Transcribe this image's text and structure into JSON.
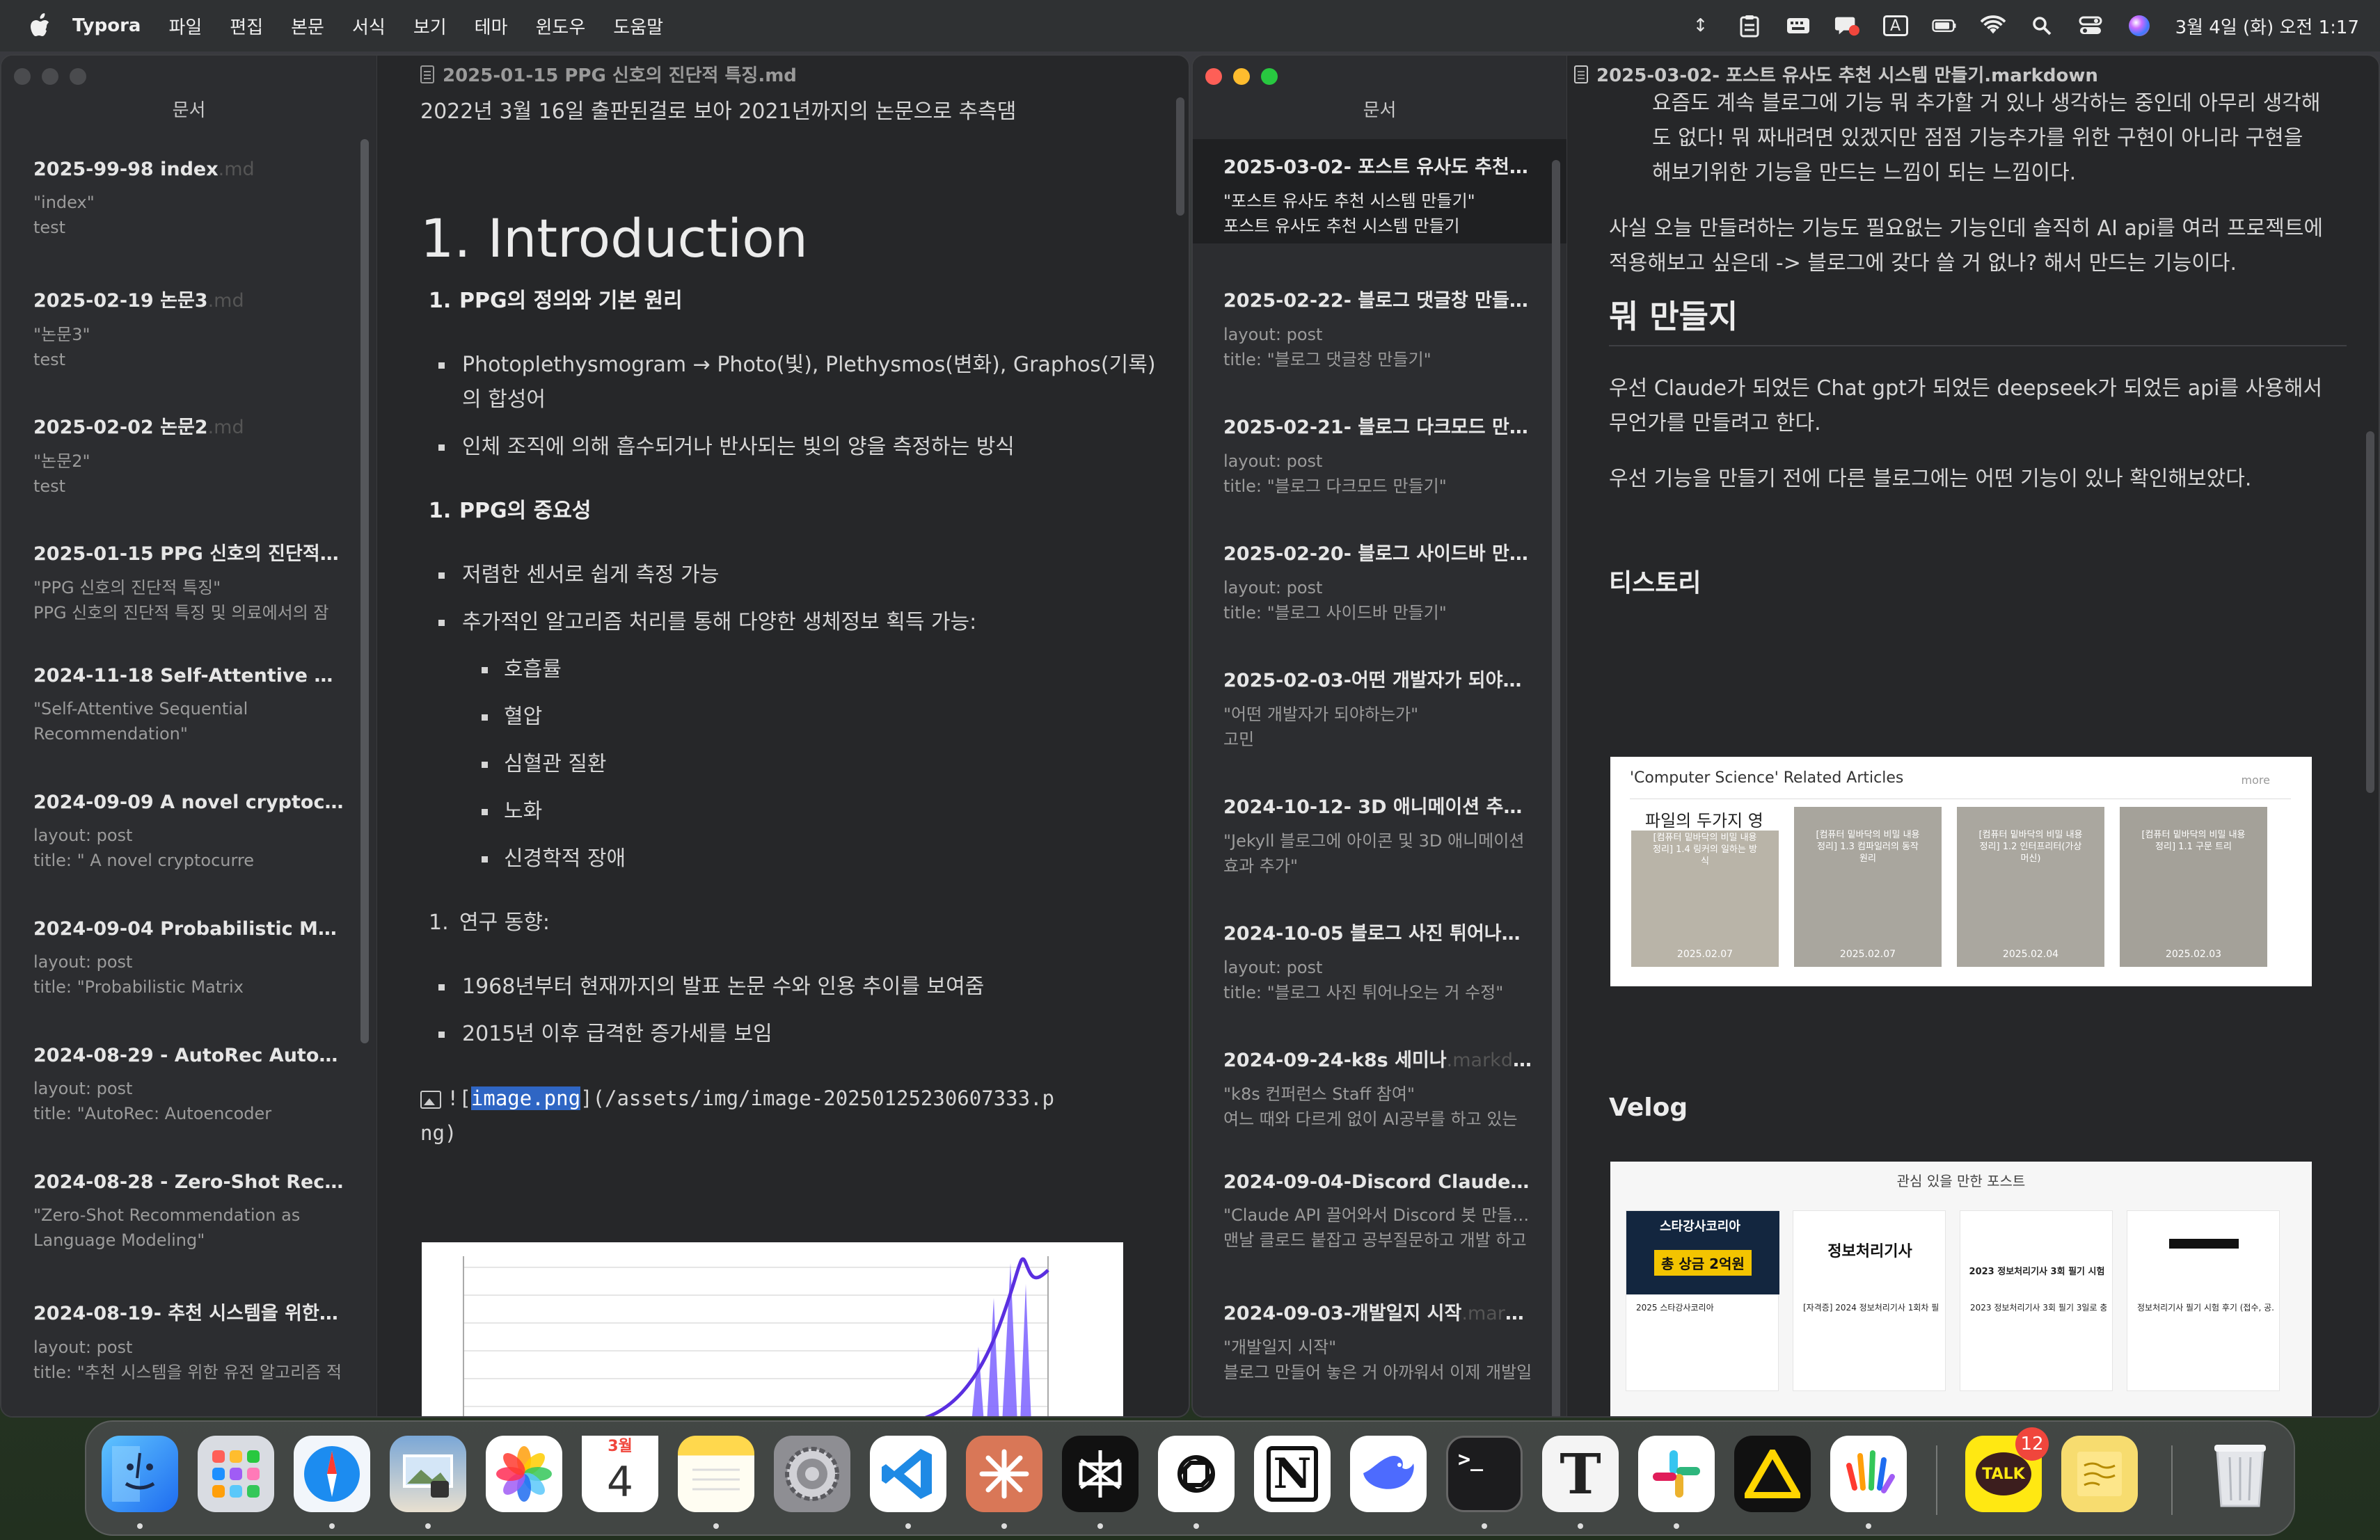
{
  "menubar": {
    "app_name": "Typora",
    "menus": [
      "파일",
      "편집",
      "본문",
      "서식",
      "보기",
      "테마",
      "윈도우",
      "도움말"
    ],
    "input_indicator": "A",
    "clock": "3월 4일 (화) 오전 1:17"
  },
  "left_window": {
    "sidebar_title": "문서",
    "files": [
      {
        "title": "2025-99-98 index",
        "ext": ".md",
        "line1": "\"index\"",
        "line2": "test"
      },
      {
        "title": "2025-02-19 논문3",
        "ext": ".md",
        "line1": "\"논문3\"",
        "line2": "test"
      },
      {
        "title": "2025-02-02 논문2",
        "ext": ".md",
        "line1": "\"논문2\"",
        "line2": "test"
      },
      {
        "title": "2025-01-15 PPG 신호의 진단적 특...",
        "ext": "",
        "line1": "\"PPG 신호의 진단적 특징\"",
        "line2": "PPG 신호의 진단적 특징 및 의료에서의 잠"
      },
      {
        "title": "2024-11-18 Self-Attentive Sequ...",
        "ext": "",
        "line1": "\"Self-Attentive Sequential",
        "line2": "Recommendation\""
      },
      {
        "title": "2024-09-09 A novel cryptocurre...",
        "ext": "",
        "line1": "layout: post",
        "line2": "title: \" A novel cryptocurre"
      },
      {
        "title": "2024-09-04 Probabilistic Matrix...",
        "ext": "",
        "line1": "layout: post",
        "line2": "title: \"Probabilistic Matrix"
      },
      {
        "title": "2024-08-29 - AutoRec Autoenc...",
        "ext": "",
        "line1": "layout: post",
        "line2": "title: \"AutoRec: Autoencoder"
      },
      {
        "title": "2024-08-28 - Zero-Shot Recom...",
        "ext": "",
        "line1": "\"Zero-Shot Recommendation as",
        "line2": "Language Modeling\""
      },
      {
        "title": "2024-08-19- 추천 시스템을 위한 유...",
        "ext": "",
        "line1": "layout: post",
        "line2": "title: \"추천 시스템을 위한 유전 알고리즘 적"
      }
    ],
    "editor_file": "2025-01-15 PPG 신호의 진단적 특징.md",
    "intro_line": "2022년 3월 16일 출판된걸로 보아 2021년까지의 논문으로 추측댐",
    "h1": "1. Introduction",
    "sec1_num": "1.",
    "sec1_title": "PPG의 정의와 기본 원리",
    "sec1_b1a": "Photoplethysmogram → Photo(빛), Plethysmos(변화), Graphos(기록)",
    "sec1_b1b": "의 합성어",
    "sec1_b2": "인체 조직에 의해 흡수되거나 반사되는 빛의 양을 측정하는 방식",
    "sec2_num": "1.",
    "sec2_title": "PPG의 중요성",
    "sec2_b1": "저렴한 센서로 쉽게 측정 가능",
    "sec2_b2": "추가적인 알고리즘 처리를 통해 다양한 생체정보 획득 가능:",
    "sec2_sub": [
      "호흡률",
      "혈압",
      "심혈관 질환",
      "노화",
      "신경학적 장애"
    ],
    "sec3_num": "1.",
    "sec3_title": "연구 동향:",
    "sec3_b1": "1968년부터 현재까지의 발표 논문 수와 인용 추이를 보여줌",
    "sec3_b2": "2015년 이후 급격한 증가세를 보임",
    "img_prefix": "![",
    "img_alt": "image.png",
    "img_path_a": "](/assets/img/image-20250125230607333.p",
    "img_path_b": "ng)"
  },
  "right_window": {
    "sidebar_title": "문서",
    "files": [
      {
        "title": "2025-03-02- 포스트 유사도 추천 시...",
        "ext": "",
        "line1": "\"포스트 유사도 추천 시스템 만들기\"",
        "line2": "포스트 유사도 추천 시스템 만들기"
      },
      {
        "title": "2025-02-22- 블로그 댓글창 만들기 ...",
        "ext": "",
        "line1": "layout: post",
        "line2": "title: \"블로그 댓글창 만들기\""
      },
      {
        "title": "2025-02-21- 블로그 다크모드 만들...",
        "ext": "",
        "line1": "layout: post",
        "line2": "title: \"블로그 다크모드 만들기\""
      },
      {
        "title": "2025-02-20- 블로그 사이드바 만들...",
        "ext": "",
        "line1": "layout: post",
        "line2": "title: \"블로그 사이드바 만들기\""
      },
      {
        "title": "2025-02-03-어떤 개발자가 되야하는...",
        "ext": "",
        "line1": "\"어떤 개발자가 되야하는가\"",
        "line2": "고민"
      },
      {
        "title": "2024-10-12- 3D 애니메이션 추가 ...",
        "ext": "",
        "line1": "\"Jekyll 블로그에 아이콘 및 3D 애니메이션",
        "line2": "효과 추가\""
      },
      {
        "title": "2024-10-05 블로그 사진 튀어나오는...",
        "ext": "",
        "line1": "layout: post",
        "line2": "title: \"블로그 사진 튀어나오는 거 수정\""
      },
      {
        "title": "2024-09-24-k8s 세미나",
        "ext": ".markdown",
        "line1": "\"k8s 컨퍼런스 Staff 참여\"",
        "line2": "여느 때와 다르게 없이 AI공부를 하고 있는"
      },
      {
        "title": "2024-09-04-Discord Claude",
        "ext": ".md",
        "line1": "\"Claude API 끌어와서 Discord 봇 만들기\"",
        "line2": "맨날 클로드 붙잡고 공부질문하고 개발 하고"
      },
      {
        "title": "2024-09-03-개발일지 시작",
        "ext": ".markdo...",
        "line1": "\"개발일지 시작\"",
        "line2": "블로그 만들어 놓은 거 아까워서 이제 개발일"
      }
    ],
    "editor_file": "2025-03-02- 포스트 유사도 추천 시스템 만들기.markdown",
    "p1a": "요즘도 계속 블로그에 기능 뭐 추가할 거 있나 생각하는 중인데 아무리 생각해",
    "p1b": "도 없다! 뭐 짜내려면 있겠지만 점점 기능추가를 위한 구현이 아니라 구현을",
    "p1c": "해보기위한 기능을 만드는 느낌이 되는 느낌이다.",
    "p2a": "사실 오늘 만들려하는 기능도 필요없는 기능인데 솔직히 AI api를 여러 프로젝트에",
    "p2b": "적용해보고 싶은데  -> 블로그에 갖다 쓸 거 없나? 해서 만드는 기능이다.",
    "h_make": "뭐 만들지",
    "p3a": "우선 Claude가 되었든 Chat gpt가 되었든 deepseek가 되었든 api를 사용해서",
    "p3b": "무언가를 만들려고 한다.",
    "p4": "우선 기능을 만들기 전에 다른 블로그에는 어떤 기능이 있나 확인해보았다.",
    "h_tistory": "티스토리",
    "tistory_header": "'Computer Science' Related Articles",
    "tistory_more": "more",
    "tistory_cards": [
      {
        "title": "[컴퓨터 밑바닥의 비밀 내용 정리] 1.4 링커의 일하는 방식",
        "date": "2025.02.07"
      },
      {
        "title": "[컴퓨터 밑바닥의 비밀 내용 정리] 1.3 컴파일러의 동작 원리",
        "date": "2025.02.07"
      },
      {
        "title": "[컴퓨터 밑바닥의 비밀 내용 정리] 1.2 인터프리터(가상 머신)",
        "date": "2025.02.04"
      },
      {
        "title": "[컴퓨터 밑바닥의 비밀 내용 정리] 1.1 구문 트리",
        "date": "2025.02.03"
      }
    ],
    "tistory_side": "파일의 두가지 영",
    "h_velog": "Velog",
    "velog_header": "관심 있을 만한 포스트",
    "velog_cards": [
      {
        "top": "스타강사코리아",
        "mid": "총 상금 2억원",
        "title": "2025 스타강사코리아"
      },
      {
        "top": "",
        "mid": "정보처리기사",
        "title": "[자격증] 2024 정보처리기사 1회차 필기 ..."
      },
      {
        "top": "",
        "mid": "2023 정보처리기사 3회 필기 시험",
        "title": "2023 정보처리기사 3회 필기 3일로 충분하다?"
      },
      {
        "top": "",
        "mid": "",
        "title": "정보처리기사 필기 시험 후기 (접수, 공..."
      }
    ]
  },
  "dock": {
    "calendar_month": "3월",
    "calendar_day": "4",
    "talk_label": "TALK",
    "talk_badge": "12",
    "terminal_prompt": ">_",
    "notion_letter": "N",
    "typora_letter": "T"
  }
}
